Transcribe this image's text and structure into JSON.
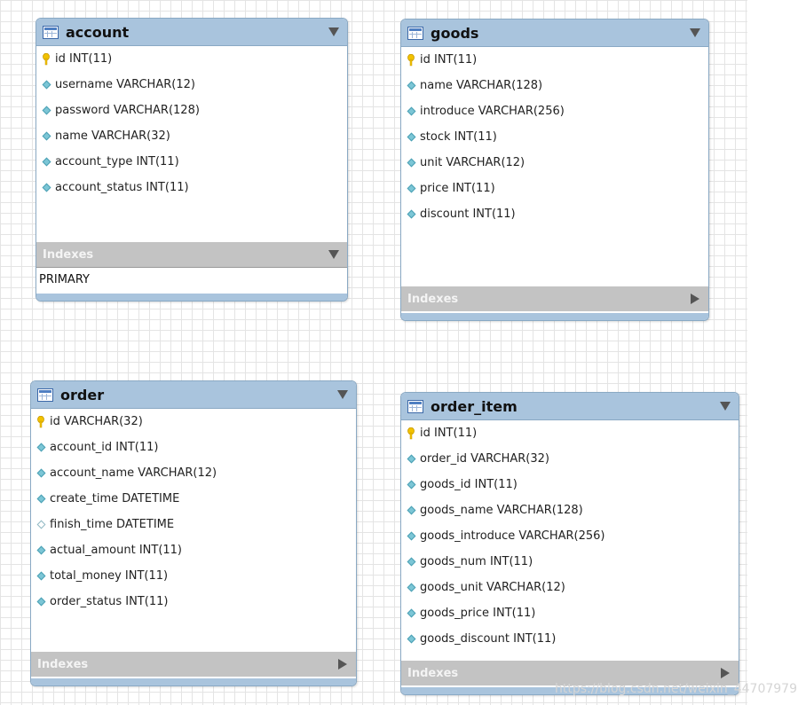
{
  "tables": {
    "account": {
      "title": "account",
      "columns": [
        {
          "text": "id INT(11)",
          "icon": "key-icon"
        },
        {
          "text": "username VARCHAR(12)",
          "icon": "diamond-icon"
        },
        {
          "text": "password VARCHAR(128)",
          "icon": "diamond-icon"
        },
        {
          "text": "name VARCHAR(32)",
          "icon": "diamond-icon"
        },
        {
          "text": "account_type INT(11)",
          "icon": "diamond-icon"
        },
        {
          "text": "account_status INT(11)",
          "icon": "diamond-icon"
        }
      ],
      "indexes_label": "Indexes",
      "indexes": [
        "PRIMARY"
      ]
    },
    "goods": {
      "title": "goods",
      "columns": [
        {
          "text": "id INT(11)",
          "icon": "key-icon"
        },
        {
          "text": "name VARCHAR(128)",
          "icon": "diamond-icon"
        },
        {
          "text": "introduce VARCHAR(256)",
          "icon": "diamond-icon"
        },
        {
          "text": "stock INT(11)",
          "icon": "diamond-icon"
        },
        {
          "text": "unit VARCHAR(12)",
          "icon": "diamond-icon"
        },
        {
          "text": "price INT(11)",
          "icon": "diamond-icon"
        },
        {
          "text": "discount INT(11)",
          "icon": "diamond-icon"
        }
      ],
      "indexes_label": "Indexes"
    },
    "order": {
      "title": "order",
      "columns": [
        {
          "text": "id VARCHAR(32)",
          "icon": "key-icon"
        },
        {
          "text": "account_id INT(11)",
          "icon": "diamond-icon"
        },
        {
          "text": "account_name VARCHAR(12)",
          "icon": "diamond-icon"
        },
        {
          "text": "create_time DATETIME",
          "icon": "diamond-icon"
        },
        {
          "text": "finish_time DATETIME",
          "icon": "hollow-diamond-icon"
        },
        {
          "text": "actual_amount INT(11)",
          "icon": "diamond-icon"
        },
        {
          "text": "total_money INT(11)",
          "icon": "diamond-icon"
        },
        {
          "text": "order_status INT(11)",
          "icon": "diamond-icon"
        }
      ],
      "indexes_label": "Indexes"
    },
    "order_item": {
      "title": "order_item",
      "columns": [
        {
          "text": "id INT(11)",
          "icon": "key-icon"
        },
        {
          "text": "order_id VARCHAR(32)",
          "icon": "diamond-icon"
        },
        {
          "text": "goods_id INT(11)",
          "icon": "diamond-icon"
        },
        {
          "text": "goods_name VARCHAR(128)",
          "icon": "diamond-icon"
        },
        {
          "text": "goods_introduce VARCHAR(256)",
          "icon": "diamond-icon"
        },
        {
          "text": "goods_num INT(11)",
          "icon": "diamond-icon"
        },
        {
          "text": "goods_unit VARCHAR(12)",
          "icon": "diamond-icon"
        },
        {
          "text": "goods_price INT(11)",
          "icon": "diamond-icon"
        },
        {
          "text": "goods_discount INT(11)",
          "icon": "diamond-icon"
        }
      ],
      "indexes_label": "Indexes"
    }
  },
  "watermark": "https://blog.csdn.net/weixin_44707979",
  "colors": {
    "header": "#a9c4dd",
    "border": "#8aa9c4",
    "indexes_bar": "#c3c3c3",
    "column_diamond": "#7cc6d6",
    "key": "#f2c200"
  }
}
